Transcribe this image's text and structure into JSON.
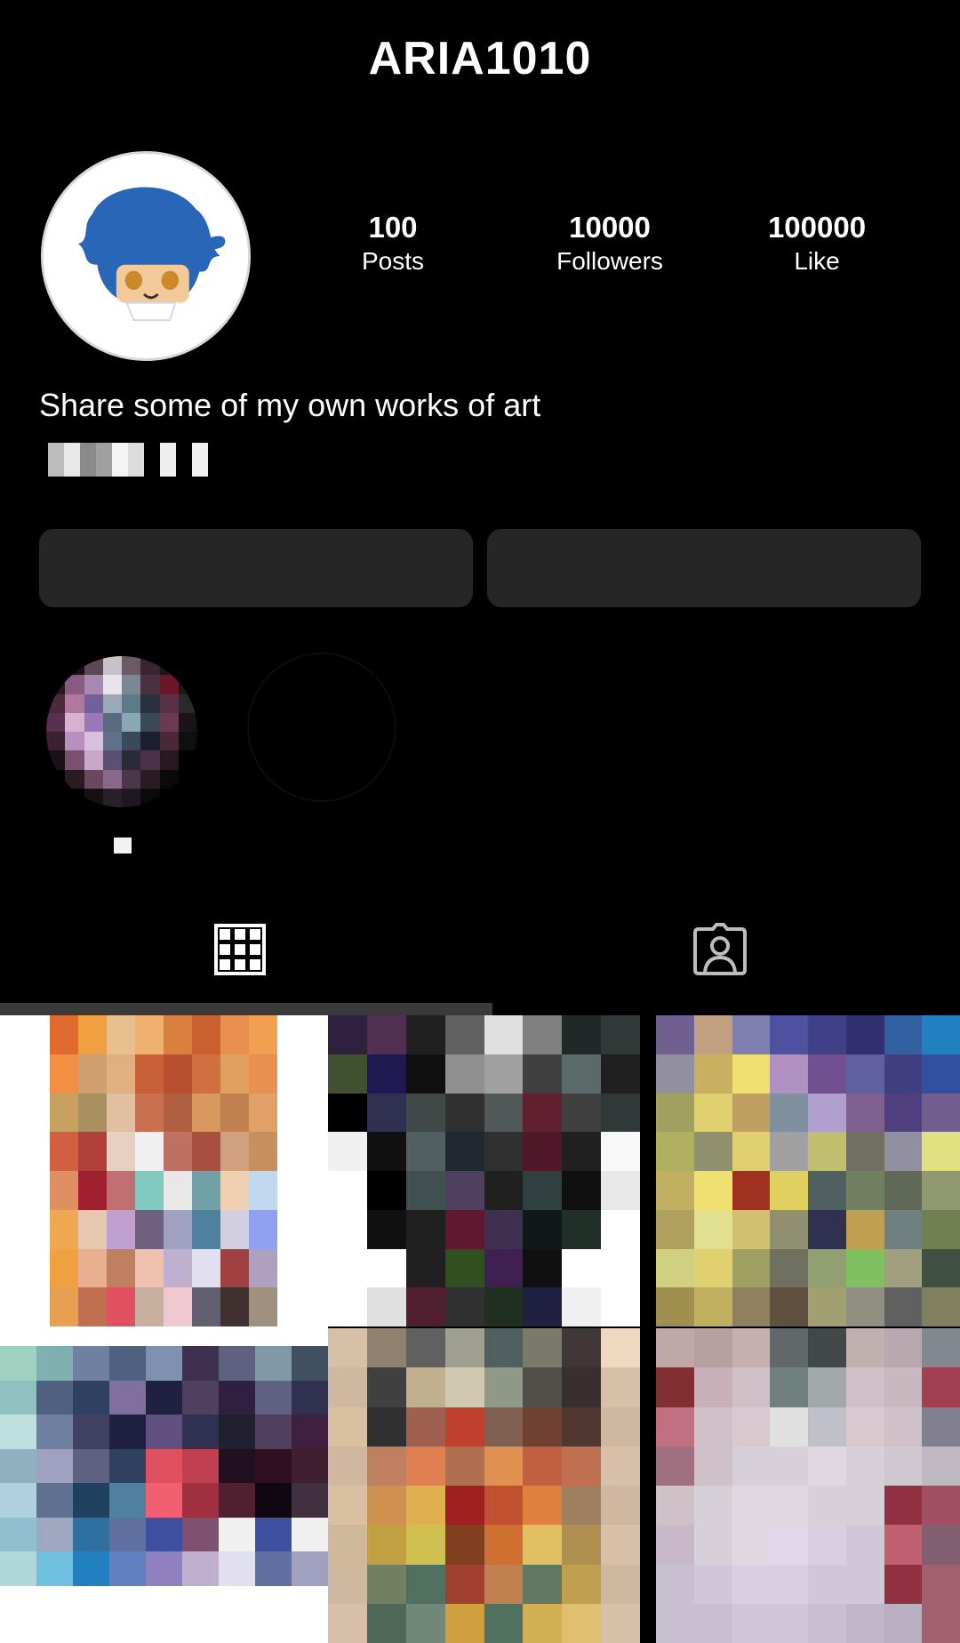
{
  "header": {
    "username": "ARIA1010"
  },
  "profile": {
    "stats": [
      {
        "value": "100",
        "label": "Posts"
      },
      {
        "value": "10000",
        "label": "Followers"
      },
      {
        "value": "100000",
        "label": "Like"
      }
    ],
    "bio": "Share some of my own works of art"
  },
  "tabs": [
    {
      "icon": "grid-icon",
      "selected": true
    },
    {
      "icon": "tagged-person-icon",
      "selected": false
    }
  ],
  "colors": {
    "background": "#000000",
    "button": "#262626",
    "text": "#ffffff",
    "tab_indicator": "#3a3a3a"
  }
}
